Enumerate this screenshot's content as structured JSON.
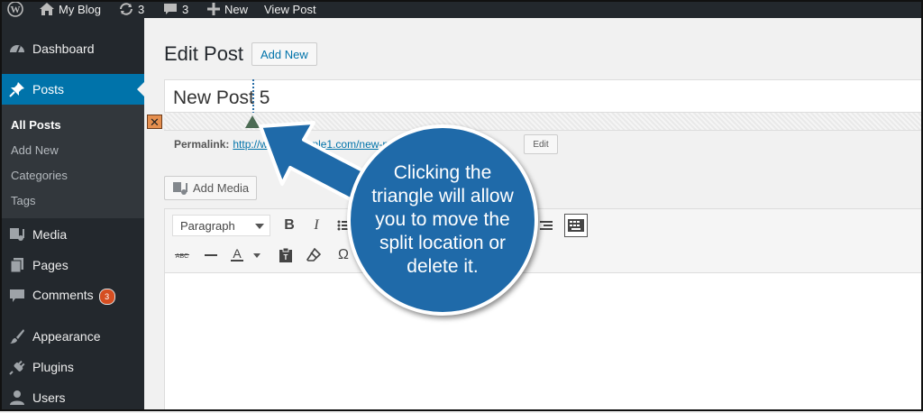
{
  "admin_bar": {
    "site_name": "My Blog",
    "updates_count": "3",
    "comments_count": "3",
    "new_label": "New",
    "view_post_label": "View Post"
  },
  "sidebar": {
    "dashboard": "Dashboard",
    "posts": "Posts",
    "submenu": [
      "All Posts",
      "Add New",
      "Categories",
      "Tags"
    ],
    "media": "Media",
    "pages": "Pages",
    "comments": "Comments",
    "comments_badge": "3",
    "appearance": "Appearance",
    "plugins": "Plugins",
    "users": "Users"
  },
  "main": {
    "page_title": "Edit Post",
    "add_new_button": "Add New",
    "post_title": "New Post 5",
    "permalink_label": "Permalink:",
    "permalink_url": "http://www.example1.com/new-post-5/",
    "edit_button": "Edit",
    "add_media_button": "Add Media"
  },
  "editor_toolbar": {
    "format_value": "Paragraph",
    "bold": "B",
    "italic": "I",
    "omega": "Ω"
  },
  "callout": {
    "text": "Clicking the triangle will allow you to move the split location or delete it."
  },
  "colors": {
    "admin_dark": "#23282d",
    "active_blue": "#0073aa",
    "callout_blue": "#1f6aa9",
    "badge_orange": "#d54e21"
  }
}
